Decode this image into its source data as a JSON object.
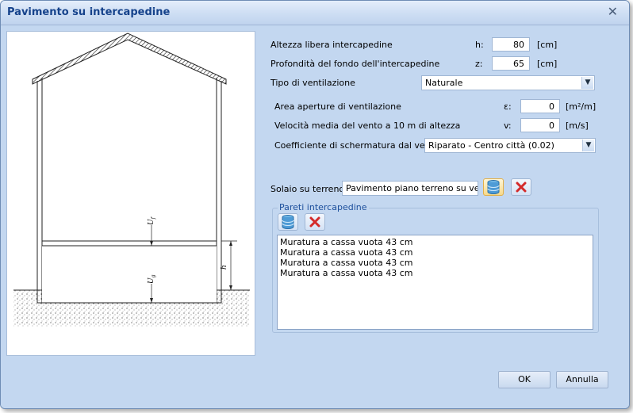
{
  "window": {
    "title": "Pavimento su intercapedine"
  },
  "fields": {
    "altezza": {
      "label": "Altezza libera intercapedine",
      "symbol": "h:",
      "value": "80",
      "unit": "[cm]"
    },
    "profondita": {
      "label": "Profondità del fondo dell'intercapedine",
      "symbol": "z:",
      "value": "65",
      "unit": "[cm]"
    },
    "tipo": {
      "label": "Tipo di ventilazione",
      "value": "Naturale"
    },
    "area": {
      "label": "Area aperture di ventilazione",
      "symbol": "ε:",
      "value": "0",
      "unit": "[m²/m]"
    },
    "velocita": {
      "label": "Velocità media del vento a 10 m di altezza",
      "symbol": "v:",
      "value": "0",
      "unit": "[m/s]"
    },
    "coefficiente": {
      "label": "Coefficiente di schermatura dal vento",
      "value": "Riparato - Centro città (0.02)"
    },
    "solaio": {
      "label": "Solaio su terreno",
      "value": "Pavimento piano terreno su vespaio"
    }
  },
  "pareti": {
    "title": "Pareti intercapedine",
    "items": [
      "Muratura a cassa vuota 43 cm",
      "Muratura a cassa vuota 43 cm",
      "Muratura a cassa vuota 43 cm",
      "Muratura a cassa vuota 43 cm"
    ]
  },
  "drawing": {
    "label_h": "h",
    "label_uf": "U",
    "label_uf_sub": "f",
    "label_ug": "U",
    "label_ug_sub": "g"
  },
  "buttons": {
    "ok": "OK",
    "cancel": "Annulla"
  },
  "icons": {
    "database": "database-icon",
    "delete": "delete-x-icon",
    "close": "close-icon",
    "dropdown": "chevron-down-icon"
  }
}
